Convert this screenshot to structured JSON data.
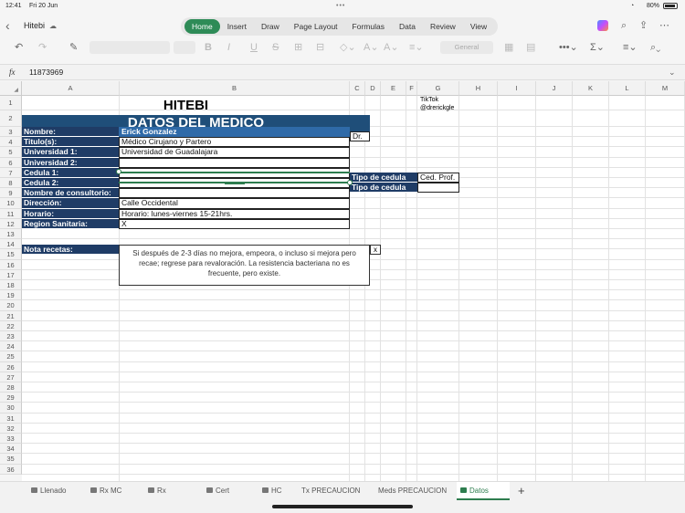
{
  "status": {
    "time": "12:41",
    "date": "Fri 20 Jun",
    "battery": "80%"
  },
  "doc": {
    "title": "Hitebi"
  },
  "ribbon": {
    "tabs": [
      "Home",
      "Insert",
      "Draw",
      "Page Layout",
      "Formulas",
      "Data",
      "Review",
      "View"
    ],
    "active": "Home",
    "number_format": "General"
  },
  "formula": {
    "fx": "fx",
    "value": "11873969"
  },
  "columns": [
    "A",
    "B",
    "C",
    "D",
    "E",
    "F",
    "G",
    "H",
    "I",
    "J",
    "K",
    "L",
    "M"
  ],
  "rows": [
    "1",
    "2",
    "3",
    "4",
    "5",
    "6",
    "7",
    "8",
    "9",
    "10",
    "11",
    "12",
    "13",
    "14",
    "15",
    "16",
    "17",
    "18",
    "19",
    "20",
    "21",
    "22",
    "23",
    "24",
    "25",
    "26",
    "27",
    "28",
    "29",
    "30",
    "31",
    "32",
    "33",
    "34",
    "35",
    "36"
  ],
  "sheet": {
    "title": "HITEBI",
    "banner": "DATOS DEL MEDICO",
    "tiktok_label": "TikTok",
    "tiktok_handle": "@drerickgle",
    "dr": "Dr.",
    "fields": [
      {
        "label": "Nombre:",
        "value": "Erick Gonzalez"
      },
      {
        "label": "Titulo(s):",
        "value": "Médico Cirujano y Partero"
      },
      {
        "label": "Universidad 1:",
        "value": "Universidad de Guadalajara"
      },
      {
        "label": "Universidad 2:",
        "value": ""
      },
      {
        "label": "Cedula 1:",
        "value": ""
      },
      {
        "label": "Cedula 2:",
        "value": ""
      },
      {
        "label": "Nombre de consultorio:",
        "value": ""
      },
      {
        "label": "Dirección:",
        "value": "Calle Occidental"
      },
      {
        "label": "Horario:",
        "value": "Horario: lunes-viernes 15-21hrs."
      },
      {
        "label": "Region Sanitaria:",
        "value": "X"
      }
    ],
    "tipo1_label": "Tipo de cedula",
    "tipo1_value": "Ced. Prof.",
    "tipo2_label": "Tipo de cedula",
    "tipo2_value": "",
    "nota_label": "Nota recetas:",
    "nota_text": "Si después de 2-3 días no mejora, empeora, o incluso si mejora pero recae; regrese para revaloración. La resistencia bacteriana no es frecuente, pero existe.",
    "close": "x"
  },
  "sheet_tabs": [
    "Llenado",
    "Rx MC",
    "Rx",
    "Cert",
    "HC",
    "Tx PRECAUCION",
    "Meds PRECAUCION",
    "Datos"
  ],
  "active_sheet": "Datos",
  "add_sheet": "+"
}
